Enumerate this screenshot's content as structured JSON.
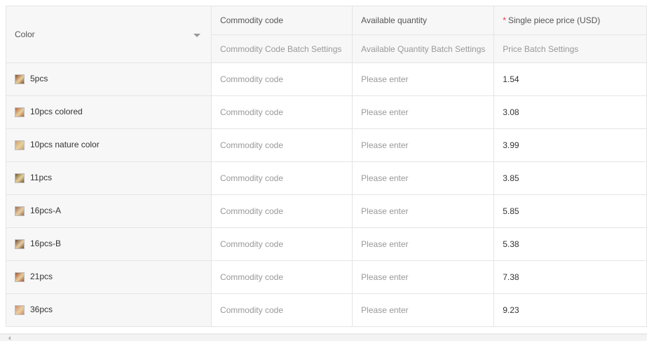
{
  "header": {
    "color_label": "Color",
    "commodity_code_label": "Commodity code",
    "available_quantity_label": "Available quantity",
    "price_required_mark": "*",
    "price_label": "Single piece price (USD)",
    "commodity_code_batch": "Commodity Code Batch Settings",
    "available_quantity_batch": "Available Quantity Batch Settings",
    "price_batch": "Price Batch Settings"
  },
  "rows": [
    {
      "color": "5pcs",
      "code_placeholder": "Commodity code",
      "qty_placeholder": "Please enter",
      "price": "1.54"
    },
    {
      "color": "10pcs colored",
      "code_placeholder": "Commodity code",
      "qty_placeholder": "Please enter",
      "price": "3.08"
    },
    {
      "color": "10pcs nature color",
      "code_placeholder": "Commodity code",
      "qty_placeholder": "Please enter",
      "price": "3.99"
    },
    {
      "color": "11pcs",
      "code_placeholder": "Commodity code",
      "qty_placeholder": "Please enter",
      "price": "3.85"
    },
    {
      "color": "16pcs-A",
      "code_placeholder": "Commodity code",
      "qty_placeholder": "Please enter",
      "price": "5.85"
    },
    {
      "color": "16pcs-B",
      "code_placeholder": "Commodity code",
      "qty_placeholder": "Please enter",
      "price": "5.38"
    },
    {
      "color": "21pcs",
      "code_placeholder": "Commodity code",
      "qty_placeholder": "Please enter",
      "price": "7.38"
    },
    {
      "color": "36pcs",
      "code_placeholder": "Commodity code",
      "qty_placeholder": "Please enter",
      "price": "9.23"
    }
  ],
  "thumb_colors": [
    "#8a4a2a",
    "#b5653a",
    "#c9a070",
    "#6b5a2a",
    "#9a6a5a",
    "#6e4a3a",
    "#a0502e",
    "#d08a70"
  ]
}
